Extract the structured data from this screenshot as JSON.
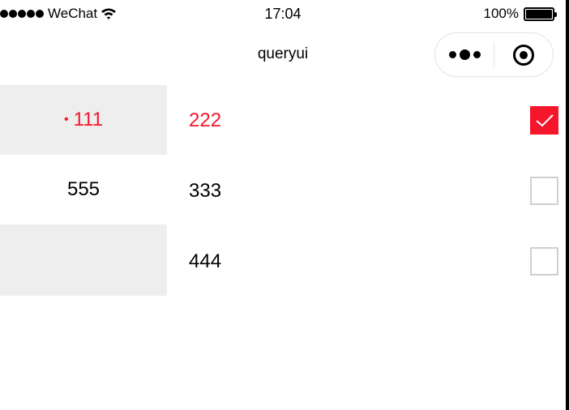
{
  "status_bar": {
    "carrier": "WeChat",
    "time": "17:04",
    "battery": "100%",
    "battery_level": 1.0
  },
  "nav": {
    "title": "queryui",
    "more_icon": "more-dots-icon",
    "close_icon": "close-circle-icon"
  },
  "categories": [
    {
      "label": "111",
      "active": true
    },
    {
      "label": "555",
      "active": false
    },
    {
      "label": "",
      "active": false
    }
  ],
  "items": [
    {
      "label": "222",
      "checked": true
    },
    {
      "label": "333",
      "checked": false
    },
    {
      "label": "444",
      "checked": false
    }
  ],
  "colors": {
    "accent": "#f5162b",
    "sidebar_bg": "#eeeeee",
    "checkbox_border": "#cfcfcf"
  }
}
